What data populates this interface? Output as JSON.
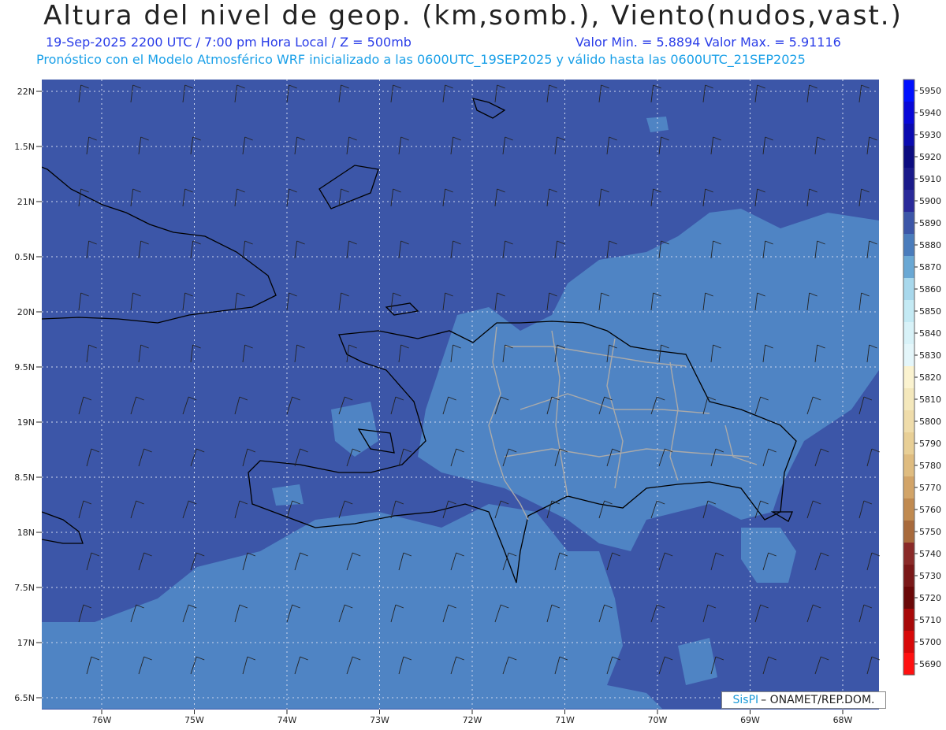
{
  "header": {
    "title": "Altura del nivel de geop. (km,somb.), Viento(nudos,vast.)",
    "subtitle_left": "19-Sep-2025  2200 UTC / 7:00 pm Hora Local / Z = 500mb",
    "subtitle_right": "Valor Min. = 5.8894  Valor Max. = 5.91116",
    "subtitle_model": "Pronóstico con el Modelo Atmosférico WRF inicializado a las 0600UTC_19SEP2025 y válido hasta las  0600UTC_21SEP2025"
  },
  "axes": {
    "lat_labels": [
      "22N",
      "1.5N",
      "21N",
      "0.5N",
      "20N",
      "9.5N",
      "19N",
      "8.5N",
      "18N",
      "7.5N",
      "17N",
      "6.5N"
    ],
    "lon_labels": [
      "76W",
      "75W",
      "74W",
      "73W",
      "72W",
      "71W",
      "70W",
      "69W",
      "68W"
    ],
    "lat_range": [
      16.5,
      22
    ],
    "lon_range": [
      -76.65,
      -67.4
    ]
  },
  "colorbar": {
    "levels": [
      "5950",
      "5940",
      "5930",
      "5920",
      "5910",
      "5900",
      "5890",
      "5880",
      "5870",
      "5860",
      "5850",
      "5840",
      "5830",
      "5820",
      "5810",
      "5800",
      "5790",
      "5780",
      "5770",
      "5760",
      "5750",
      "5740",
      "5730",
      "5720",
      "5710",
      "5700",
      "5690"
    ],
    "colors": [
      "#0010ff",
      "#0808d8",
      "#0a0ab0",
      "#0c0c80",
      "#1a1a8a",
      "#2a2a9a",
      "#3c56a8",
      "#4a7cbc",
      "#6aa8d4",
      "#a8d8ec",
      "#c4eaf4",
      "#d8f2f8",
      "#e4f6fa",
      "#fbf3d0",
      "#f4e8bc",
      "#efdcaa",
      "#e8cf96",
      "#dfbc80",
      "#d2a468",
      "#c08a50",
      "#a86a3c",
      "#8a2a28",
      "#7a1818",
      "#6a0808",
      "#a80808",
      "#d80808",
      "#ff1010"
    ]
  },
  "map_colors": {
    "dark_region": "#3c56a8",
    "light_region": "#4f84c4",
    "coast": "#000000",
    "border": "#aaaaaa",
    "grid": "#cfd8ee"
  },
  "credit": {
    "logo": "SisPI",
    "text": "– ONAMET/REP.DOM."
  }
}
